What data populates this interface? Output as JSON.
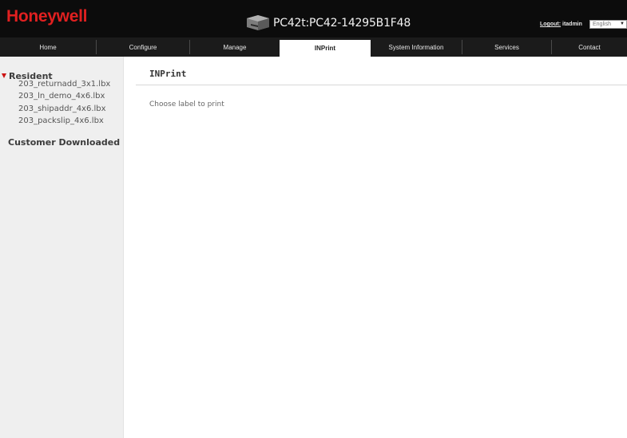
{
  "header": {
    "logo": "Honeywell",
    "device_title": "PC42t:PC42-14295B1F48",
    "logout_label": "Logout:",
    "user": "itadmin",
    "language_selected": "English"
  },
  "nav": {
    "items": [
      {
        "label": "Home"
      },
      {
        "label": "Configure"
      },
      {
        "label": "Manage"
      },
      {
        "label": "INPrint"
      },
      {
        "label": "System Information"
      },
      {
        "label": "Services"
      },
      {
        "label": "Contact"
      }
    ],
    "active": "INPrint"
  },
  "sidebar": {
    "resident_label": "Resident",
    "files": [
      {
        "name": "203_returnadd_3x1.lbx"
      },
      {
        "name": "203_ln_demo_4x6.lbx"
      },
      {
        "name": "203_shipaddr_4x6.lbx"
      },
      {
        "name": "203_packslip_4x6.lbx"
      }
    ],
    "customer_label": "Customer Downloaded"
  },
  "main": {
    "title": "INPrint",
    "instruction": "Choose label to print"
  },
  "colors": {
    "brand_red": "#e02020",
    "header_bg": "#0c0c0c",
    "nav_bg": "#1b1b1b",
    "sidebar_bg": "#efefef",
    "tree_arrow": "#cc1111"
  }
}
